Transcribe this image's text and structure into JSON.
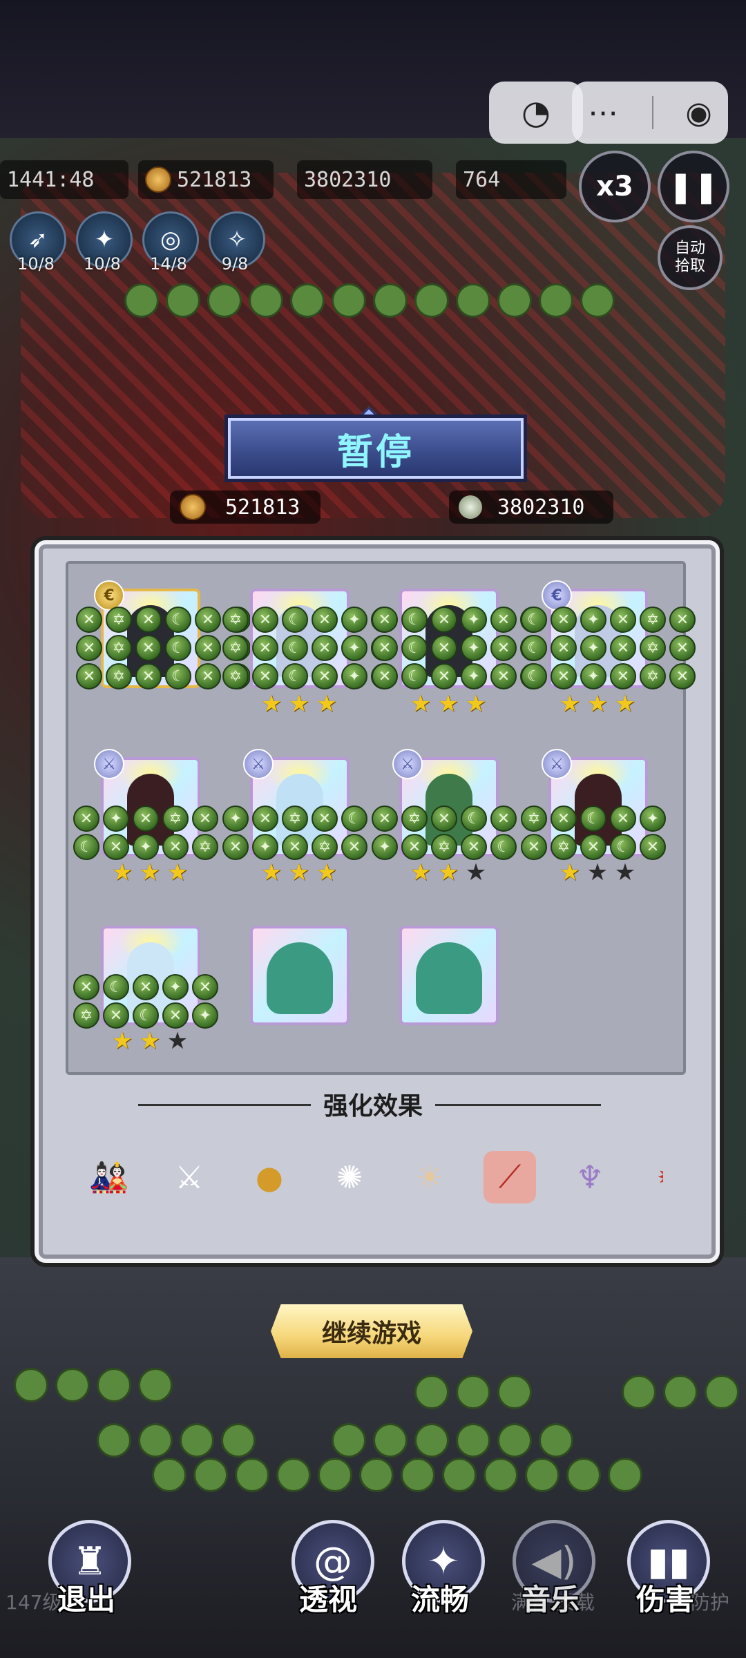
{
  "hud": {
    "timer": "1441:48",
    "gold": "521813",
    "kills": "3802310",
    "enemies": "764",
    "speed": "x3",
    "auto_pickup_line1": "自动",
    "auto_pickup_line2": "拾取",
    "skills": [
      {
        "icon": "feather-icon",
        "label": "10/8"
      },
      {
        "icon": "wing-icon",
        "label": "10/8"
      },
      {
        "icon": "vortex-icon",
        "label": "14/8"
      },
      {
        "icon": "claw-icon",
        "label": "9/8"
      }
    ]
  },
  "pause": {
    "title": "暂停",
    "gold": "521813",
    "kills": "3802310"
  },
  "heroes": [
    {
      "badge": "€",
      "stars": 0
    },
    {
      "badge": "",
      "stars": 3
    },
    {
      "badge": "",
      "stars": 3
    },
    {
      "badge": "€",
      "stars": 3
    },
    {
      "badge": "⚔",
      "stars": 3
    },
    {
      "badge": "⚔",
      "stars": 3
    },
    {
      "badge": "⚔",
      "stars": 2
    },
    {
      "badge": "⚔",
      "stars": 1
    },
    {
      "badge": "",
      "stars": 2
    },
    {
      "badge": "",
      "stars": 0
    },
    {
      "badge": "",
      "stars": 0
    }
  ],
  "effects": {
    "title": "强化效果",
    "icons": [
      "puppet-icon",
      "crossed-swords-icon",
      "coin-icon",
      "firework-icon",
      "strength-icon",
      "blade-icon",
      "potion-icon",
      "flame-icon"
    ]
  },
  "continue_label": "继续游戏",
  "nav": {
    "exit": "退出",
    "perspective": "透视",
    "smooth": "流畅",
    "music": "音乐",
    "damage": "伤害",
    "level_ghost": "147级",
    "ghost_right": "满音 反载",
    "ghost_protect": "防护"
  },
  "colors": {
    "panel_bg": "#c9cbd6",
    "orb_green": "#3b6f24",
    "star_gold": "#f2c81c",
    "banner_text": "#8ff5ff"
  }
}
